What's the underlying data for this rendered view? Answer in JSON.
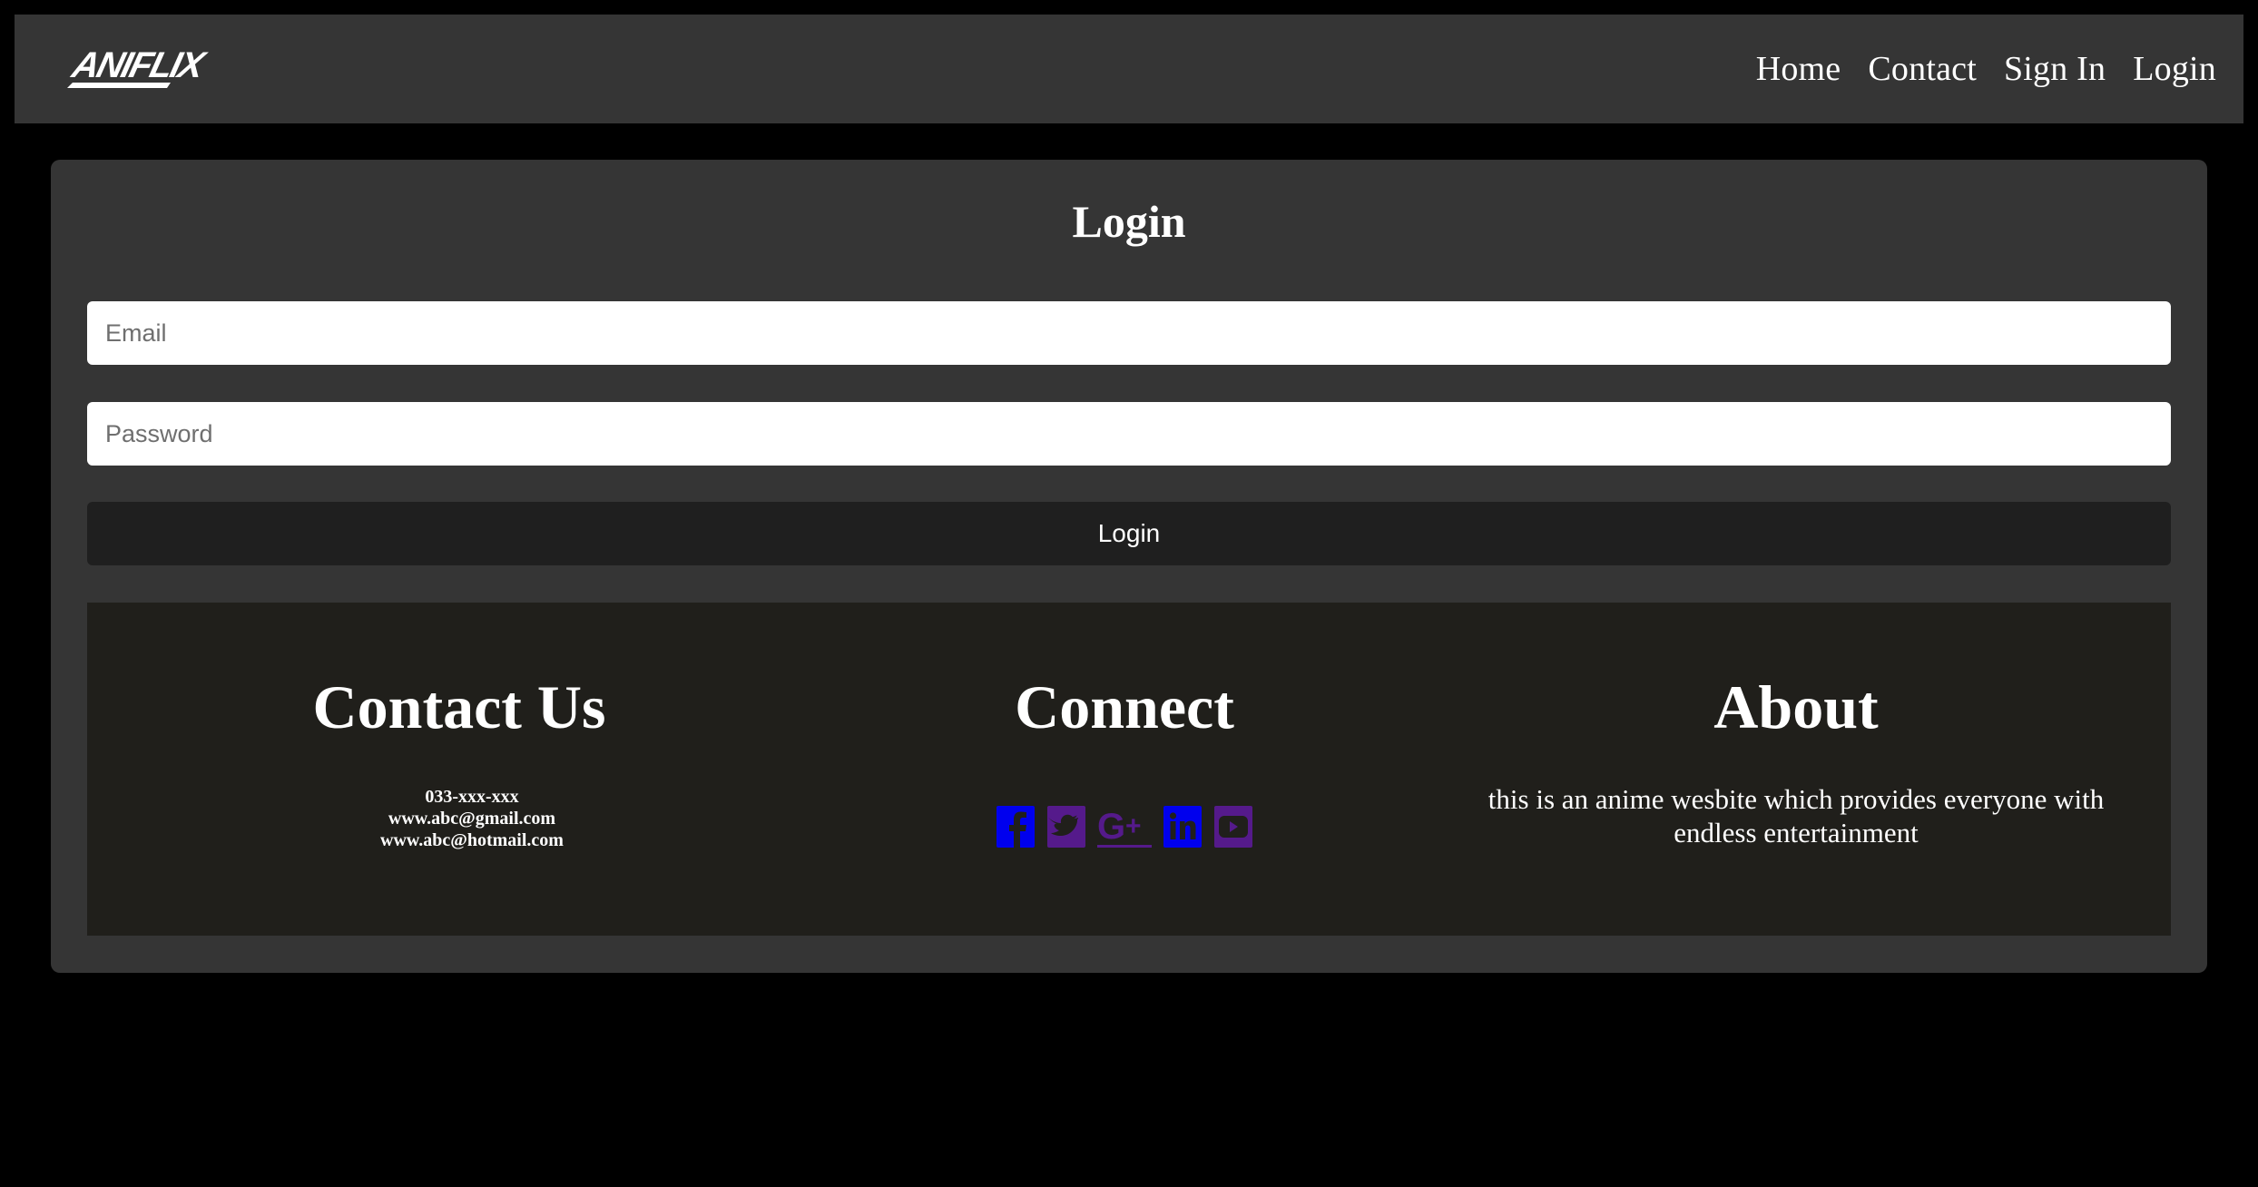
{
  "header": {
    "logo_text": "ANIFLIX",
    "nav": [
      {
        "label": "Home"
      },
      {
        "label": "Contact"
      },
      {
        "label": "Sign In"
      },
      {
        "label": "Login"
      }
    ]
  },
  "login": {
    "title": "Login",
    "email_placeholder": "Email",
    "password_placeholder": "Password",
    "submit_label": "Login"
  },
  "footer": {
    "contact": {
      "heading": "Contact Us",
      "lines": [
        "033-xxx-xxx",
        "www.abc@gmail.com",
        "www.abc@hotmail.com"
      ]
    },
    "connect": {
      "heading": "Connect",
      "icons": [
        "facebook-icon",
        "twitter-icon",
        "google-plus-icon",
        "linkedin-icon",
        "youtube-icon"
      ]
    },
    "about": {
      "heading": "About",
      "text": "this is an anime wesbite which provides everyone with endless entertainment"
    }
  },
  "colors": {
    "page_bg": "#000000",
    "panel_bg": "#353535",
    "footer_bg": "#201f1b",
    "button_bg": "#1f1f1f",
    "link_blue": "#0000ee",
    "link_visited": "#551a8b"
  }
}
